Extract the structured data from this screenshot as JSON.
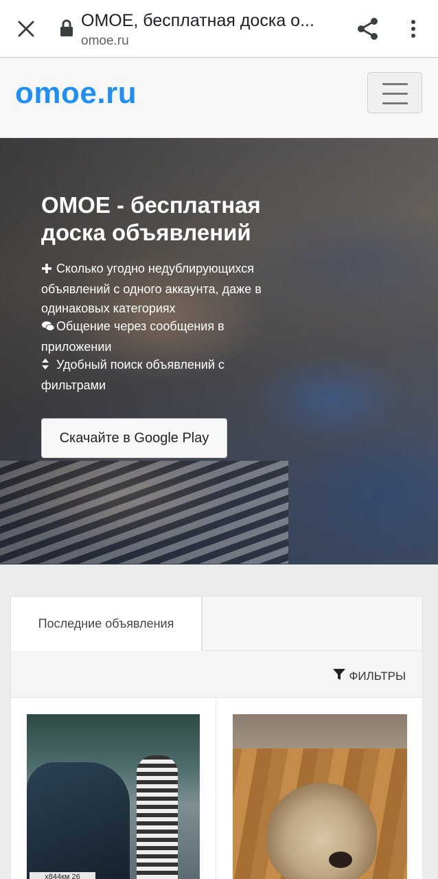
{
  "browser": {
    "title": "ОМОЕ, бесплатная доска о...",
    "url": "omoe.ru",
    "close_icon": "close-icon",
    "lock_icon": "lock-icon",
    "share_icon": "share-icon",
    "more_icon": "more-vert-icon"
  },
  "site": {
    "logo": "omoe.ru",
    "menu_icon": "hamburger-icon",
    "brand_color": "#1f8ff3"
  },
  "hero": {
    "title": "ОМОЕ - бесплатная доска объявлений",
    "features": [
      {
        "icon": "plus-icon",
        "text": "Сколько угодно недублирующихся объявлений с одного аккаунта, даже в одинаковых категориях"
      },
      {
        "icon": "chat-icon",
        "text": "Общение через сообщения в приложении"
      },
      {
        "icon": "sort-icon",
        "text": "Удобный поиск объявлений с фильтрами"
      }
    ],
    "button": "Скачайте в Google Play"
  },
  "listings": {
    "tab_label": "Последние объявления",
    "filter_label": "ФИЛЬТРЫ",
    "filter_icon": "funnel-icon",
    "cards": [
      {
        "plate": "х844км 26"
      },
      {}
    ]
  }
}
